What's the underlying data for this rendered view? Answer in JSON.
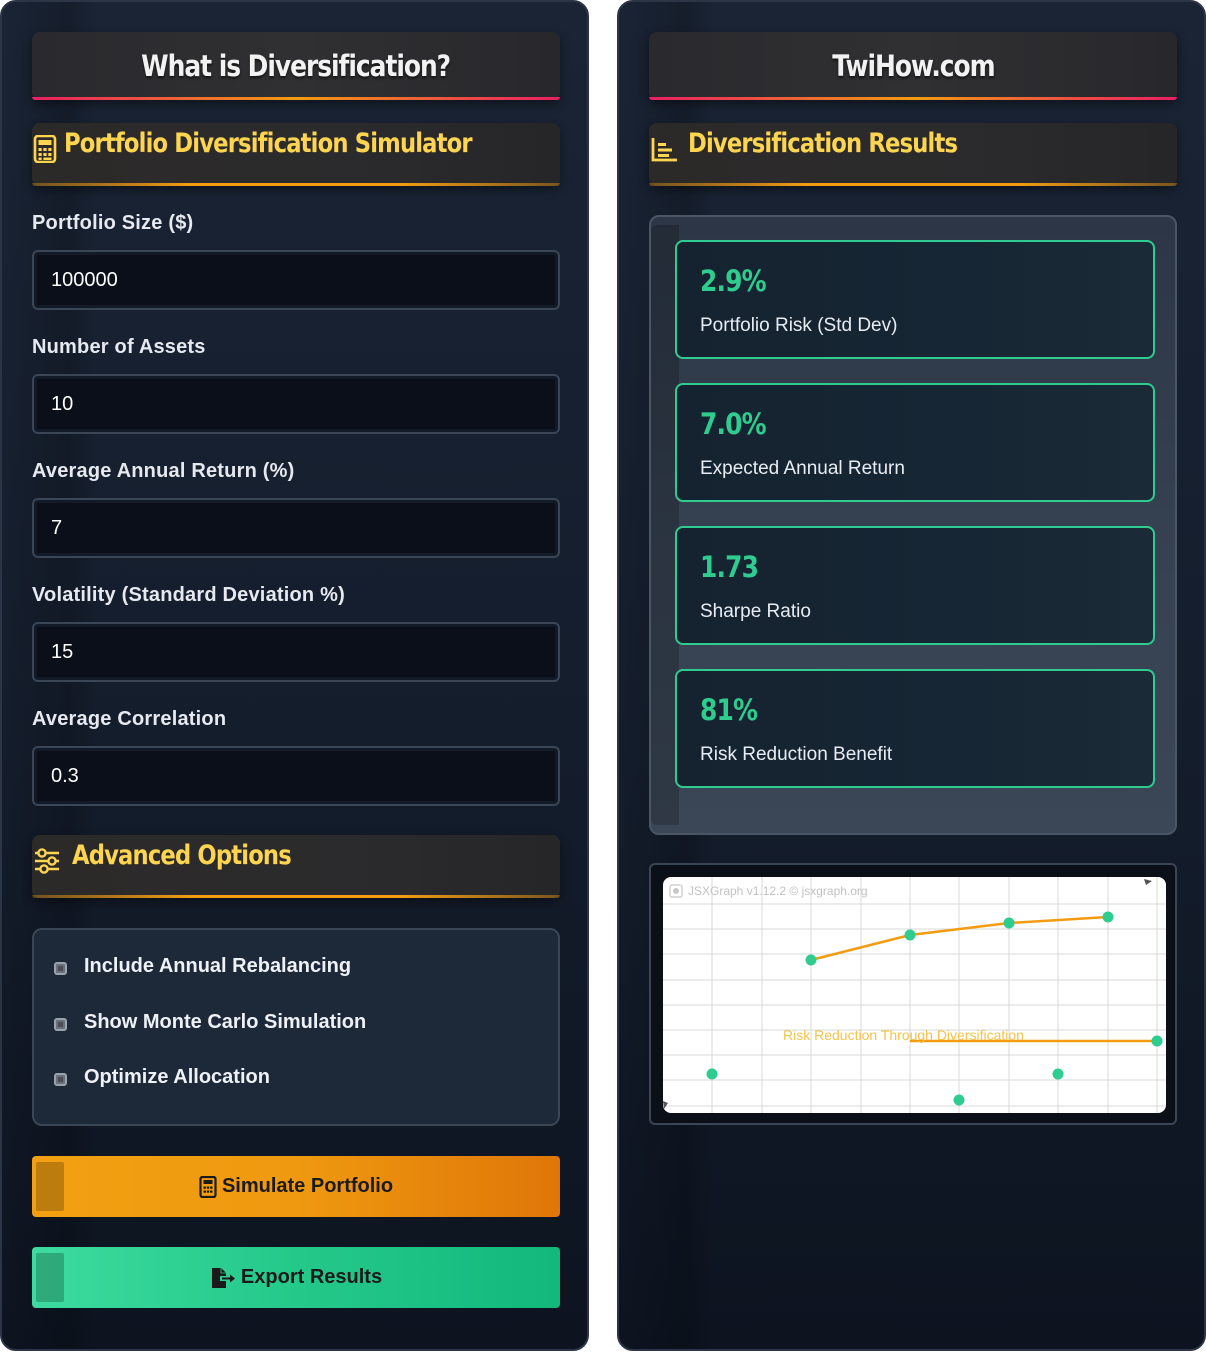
{
  "left": {
    "title": "What is Diversification?",
    "simulator_heading": "Portfolio Diversification Simulator",
    "fields": [
      {
        "label": "Portfolio Size ($)",
        "value": "100000"
      },
      {
        "label": "Number of Assets",
        "value": "10"
      },
      {
        "label": "Average Annual Return (%)",
        "value": "7"
      },
      {
        "label": "Volatility (Standard Deviation %)",
        "value": "15"
      },
      {
        "label": "Average Correlation",
        "value": "0.3"
      }
    ],
    "advanced_heading": "Advanced Options",
    "options": [
      {
        "label": "Include Annual Rebalancing",
        "checked": false
      },
      {
        "label": "Show Monte Carlo Simulation",
        "checked": false
      },
      {
        "label": "Optimize Allocation",
        "checked": false
      }
    ],
    "simulate_label": "Simulate Portfolio",
    "export_label": "Export Results"
  },
  "right": {
    "title": "TwiHow.com",
    "results_heading": "Diversification Results",
    "metrics": [
      {
        "value": "2.9%",
        "label": "Portfolio Risk (Std Dev)"
      },
      {
        "value": "7.0%",
        "label": "Expected Annual Return"
      },
      {
        "value": "1.73",
        "label": "Sharpe Ratio"
      },
      {
        "value": "81%",
        "label": "Risk Reduction Benefit"
      }
    ],
    "chart": {
      "credit": "JSXGraph v1.12.2 © jsxgraph.org",
      "annotation": "Risk Reduction Through Diversification"
    }
  },
  "colors": {
    "accent_gold": "#ffd54f",
    "accent_green": "#2ecc8f",
    "accent_orange": "#f39c12",
    "accent_pink": "#e91e63",
    "panel_bg": "#141d2c"
  },
  "icons": {
    "simulator": "calculator-icon",
    "results": "bar-chart-icon",
    "advanced": "sliders-icon",
    "simulate": "calculator-icon",
    "export": "file-export-icon"
  }
}
